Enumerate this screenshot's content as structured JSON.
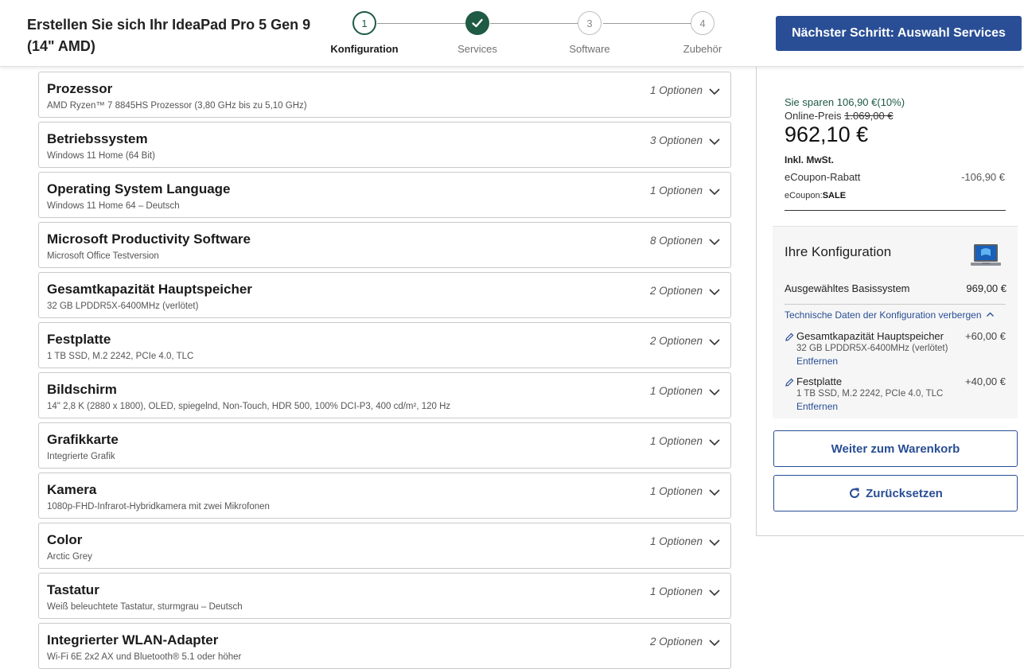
{
  "header": {
    "title": "Erstellen Sie sich Ihr IdeaPad Pro 5 Gen 9 (14\" AMD)",
    "steps": [
      {
        "number": "1",
        "label": "Konfiguration",
        "state": "active"
      },
      {
        "number": "",
        "label": "Services",
        "state": "done"
      },
      {
        "number": "3",
        "label": "Software",
        "state": "todo"
      },
      {
        "number": "4",
        "label": "Zubehör",
        "state": "todo"
      }
    ],
    "next_button": "Nächster Schritt: Auswahl Services"
  },
  "options": [
    {
      "name": "Prozessor",
      "value": "AMD Ryzen™ 7 8845HS Prozessor (3,80 GHz bis zu 5,10 GHz)",
      "count": "1 Optionen"
    },
    {
      "name": "Betriebssystem",
      "value": "Windows 11 Home (64 Bit)",
      "count": "3 Optionen"
    },
    {
      "name": "Operating System Language",
      "value": "Windows 11 Home 64 – Deutsch",
      "count": "1 Optionen"
    },
    {
      "name": "Microsoft Productivity Software",
      "value": "Microsoft Office Testversion",
      "count": "8 Optionen"
    },
    {
      "name": "Gesamtkapazität Hauptspeicher",
      "value": "32 GB LPDDR5X-6400MHz (verlötet)",
      "count": "2 Optionen"
    },
    {
      "name": "Festplatte",
      "value": "1 TB SSD, M.2 2242, PCIe 4.0, TLC",
      "count": "2 Optionen"
    },
    {
      "name": "Bildschirm",
      "value": "14\" 2,8 K (2880 x 1800), OLED, spiegelnd, Non-Touch, HDR 500, 100% DCI-P3, 400 cd/m², 120 Hz",
      "count": "1 Optionen"
    },
    {
      "name": "Grafikkarte",
      "value": "Integrierte Grafik",
      "count": "1 Optionen"
    },
    {
      "name": "Kamera",
      "value": "1080p-FHD-Infrarot-Hybridkamera mit zwei Mikrofonen",
      "count": "1 Optionen"
    },
    {
      "name": "Color",
      "value": "Arctic Grey",
      "count": "1 Optionen"
    },
    {
      "name": "Tastatur",
      "value": "Weiß beleuchtete Tastatur, sturmgrau – Deutsch",
      "count": "1 Optionen"
    },
    {
      "name": "Integrierter WLAN-Adapter",
      "value": "Wi-Fi 6E 2x2 AX und Bluetooth® 5.1 oder höher",
      "count": "2 Optionen"
    }
  ],
  "summary": {
    "savings": "Sie sparen 106,90 €(10%)",
    "online_label": "Online-Preis ",
    "old_price": "1.069,00 €",
    "price": "962,10 €",
    "tax_note": "Inkl. MwSt.",
    "ecoupon_label": "eCoupon-Rabatt",
    "ecoupon_value": "-106,90 €",
    "ecoupon_code_label": "eCoupon:",
    "ecoupon_code": "SALE"
  },
  "config": {
    "title": "Ihre Konfiguration",
    "base_label": "Ausgewähltes Basissystem",
    "base_price": "969,00 €",
    "tech_link": "Technische Daten der Konfiguration verbergen",
    "modifications": [
      {
        "name": "Gesamtkapazität Hauptspeicher",
        "price": "+60,00 €",
        "value": "32 GB LPDDR5X-6400MHz (verlötet)",
        "remove": "Entfernen"
      },
      {
        "name": "Festplatte",
        "price": "+40,00 €",
        "value": "1 TB SSD, M.2 2242, PCIe 4.0, TLC",
        "remove": "Entfernen"
      }
    ]
  },
  "actions": {
    "cart": "Weiter zum Warenkorb",
    "reset": "Zurücksetzen"
  },
  "colors": {
    "accent": "#294e95",
    "green": "#1e5a44"
  }
}
